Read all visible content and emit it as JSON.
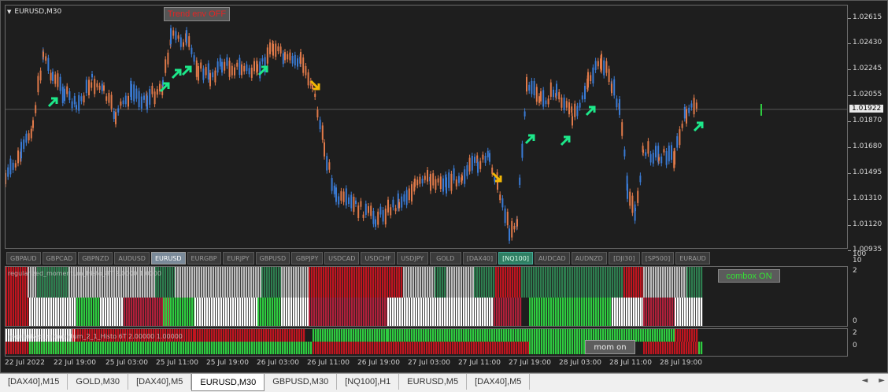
{
  "chart_header": {
    "symbol_tf": "EURUSD,M30",
    "trend_label": "Trend env OFF"
  },
  "price_axis": {
    "labels": [
      "1.02615",
      "1.02430",
      "1.02245",
      "1.02055",
      "1.01870",
      "1.01680",
      "1.01495",
      "1.01310",
      "1.01120",
      "1.00935"
    ],
    "current": "1.01922"
  },
  "symbol_buttons": [
    "GBPAUD",
    "GBPCAD",
    "GBPNZD",
    "AUDUSD",
    "EURUSD",
    "EURGBP",
    "EURJPY",
    "GBPUSD",
    "GBPJPY",
    "USDCAD",
    "USDCHF",
    "USDJPY",
    "GOLD",
    "[DAX40]",
    "[NQ100]",
    "AUDCAD",
    "AUDNZD",
    "[DJI30]",
    "[SP500]",
    "EURAUD"
  ],
  "symbol_axis": {
    "top": "100",
    "bottom": "10"
  },
  "ind1": {
    "label": "regularized_momentum_Histo_8T 2.0000 1.0000",
    "axis_top": "2",
    "axis_bottom": "0",
    "badge": "combox ON"
  },
  "ind2": {
    "label": "regularized_momentum_2_1_Histo 6T 2.00000 1.00000",
    "axis_top": "2",
    "axis_bottom": "0",
    "button": "mom on"
  },
  "time_axis": [
    "22 Jul 2022",
    "22 Jul 19:00",
    "25 Jul 03:00",
    "25 Jul 11:00",
    "25 Jul 19:00",
    "26 Jul 03:00",
    "26 Jul 11:00",
    "26 Jul 19:00",
    "27 Jul 03:00",
    "27 Jul 11:00",
    "27 Jul 19:00",
    "28 Jul 03:00",
    "28 Jul 11:00",
    "28 Jul 19:00"
  ],
  "bottom_tabs": [
    "[DAX40],M15",
    "GOLD,M30",
    "[DAX40],M5",
    "EURUSD,M30",
    "GBPUSD,M30",
    "[NQ100],H1",
    "EURUSD,M5",
    "[DAX40],M5"
  ],
  "active_tab": "EURUSD,M30",
  "colors": {
    "bull": "#3a7bd5",
    "bear": "#e07a4a",
    "arrow_up": "#1de88a",
    "arrow_down": "#f2b705",
    "red": "#c0151f",
    "green": "#2ecc40",
    "white": "#ffffff",
    "darkgreen": "#2e7d4f",
    "grey": "#bdbdbd",
    "crimson": "#b0203a"
  }
}
